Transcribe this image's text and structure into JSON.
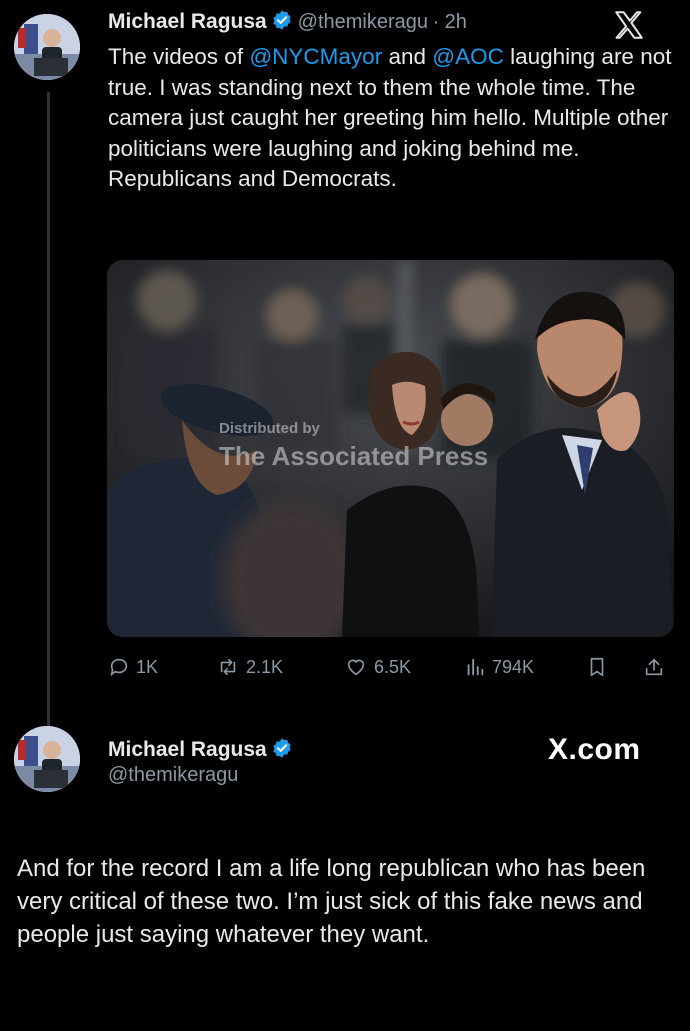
{
  "tweet": {
    "author_name": "Michael Ragusa",
    "handle": "@themikeragu",
    "time": "· 2h",
    "text_before_1": "The videos of ",
    "mention_1": "@NYCMayor",
    "text_between": " and ",
    "mention_2": "@AOC",
    "text_after": " laughing are not true. I was standing next to them the whole time. The camera just caught her greeting him hello. Multiple other politicians were laughing and joking behind me. Republicans and Democrats.",
    "media": {
      "watermark_line1": "Distributed by",
      "watermark_line2": "The Associated Press"
    },
    "actions": {
      "replies": "1K",
      "reposts": "2.1K",
      "likes": "6.5K",
      "views": "794K"
    }
  },
  "profile": {
    "name": "Michael Ragusa",
    "handle": "@themikeragu",
    "site_label": "X.com"
  },
  "followup_text": "And for the record I am a life long republican who has been very critical of these two. I’m just sick of this fake news and people just saying whatever they want.",
  "colors": {
    "background": "#000000",
    "text": "#e7e9ea",
    "secondary": "#8b98a5",
    "link": "#1d9bf0",
    "verified": "#1d9bf0"
  },
  "icons": [
    "reply-icon",
    "repost-icon",
    "like-icon",
    "views-icon",
    "bookmark-icon",
    "share-icon",
    "x-logo-icon",
    "verified-badge-icon"
  ]
}
